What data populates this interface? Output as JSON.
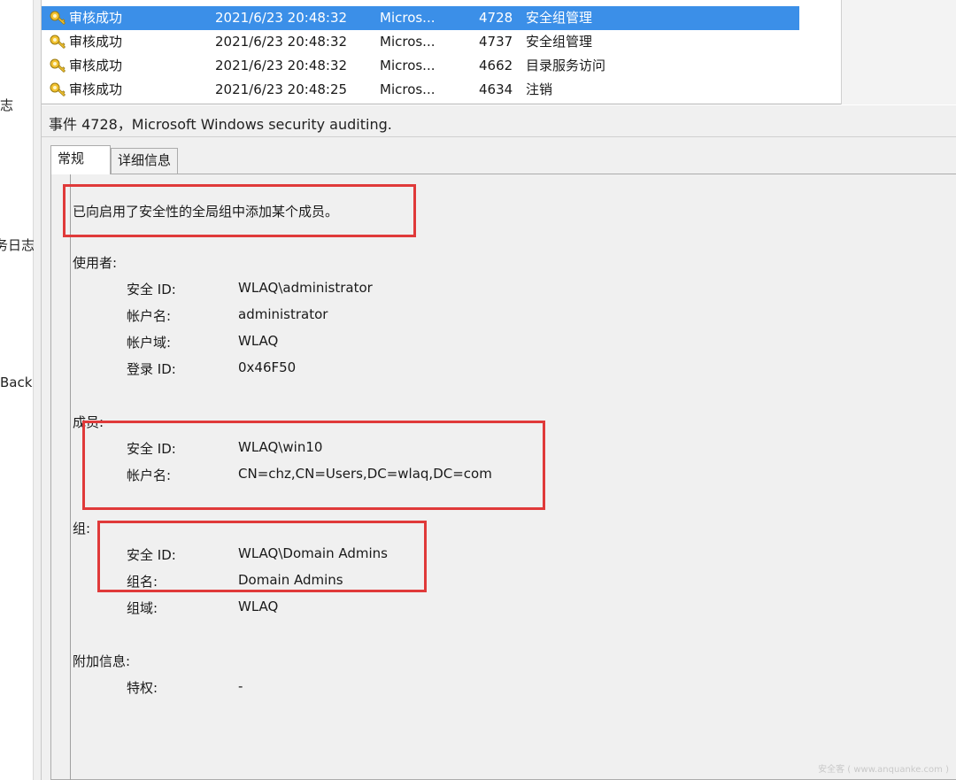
{
  "left_pane": {
    "fragments": [
      "志",
      "务日志",
      "Back"
    ]
  },
  "event_list": {
    "rows": [
      {
        "keyword": "审核成功",
        "datetime": "2021/6/23 20:48:32",
        "source": "Micros...",
        "event_id": "4728",
        "category": "安全组管理",
        "selected": true
      },
      {
        "keyword": "审核成功",
        "datetime": "2021/6/23 20:48:32",
        "source": "Micros...",
        "event_id": "4737",
        "category": "安全组管理",
        "selected": false
      },
      {
        "keyword": "审核成功",
        "datetime": "2021/6/23 20:48:32",
        "source": "Micros...",
        "event_id": "4662",
        "category": "目录服务访问",
        "selected": false
      },
      {
        "keyword": "审核成功",
        "datetime": "2021/6/23 20:48:25",
        "source": "Micros...",
        "event_id": "4634",
        "category": "注销",
        "selected": false
      }
    ],
    "icon": "audit-success-key-icon"
  },
  "detail": {
    "title": "事件 4728，Microsoft Windows security auditing.",
    "tabs": [
      {
        "label": "常规",
        "active": true
      },
      {
        "label": "详细信息",
        "active": false
      }
    ],
    "summary": "已向启用了安全性的全局组中添加某个成员。",
    "subject": {
      "heading": "使用者:",
      "fields": [
        {
          "label": "安全 ID:",
          "value": "WLAQ\\administrator"
        },
        {
          "label": "帐户名:",
          "value": "administrator"
        },
        {
          "label": "帐户域:",
          "value": "WLAQ"
        },
        {
          "label": "登录 ID:",
          "value": "0x46F50"
        }
      ]
    },
    "member": {
      "heading": "成员:",
      "fields": [
        {
          "label": "安全 ID:",
          "value": "WLAQ\\win10"
        },
        {
          "label": "帐户名:",
          "value": "CN=chz,CN=Users,DC=wlaq,DC=com"
        }
      ]
    },
    "group": {
      "heading": "组:",
      "fields": [
        {
          "label": "安全 ID:",
          "value": "WLAQ\\Domain Admins"
        },
        {
          "label": "组名:",
          "value": "Domain Admins"
        },
        {
          "label": "组域:",
          "value": "WLAQ"
        }
      ]
    },
    "additional": {
      "heading": "附加信息:",
      "fields": [
        {
          "label": "特权:",
          "value": "-"
        }
      ]
    }
  },
  "colors": {
    "selection": "#3b8fe8",
    "annotation": "#e03a3a",
    "panel": "#f0f0f0"
  },
  "watermark": "安全客 ( www.anquanke.com )"
}
